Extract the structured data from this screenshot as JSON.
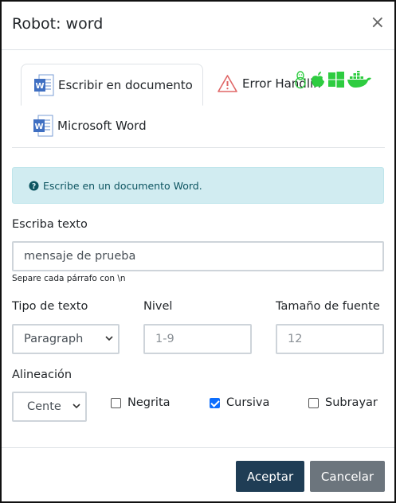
{
  "modal": {
    "title": "Robot: word",
    "close_symbol": "×"
  },
  "tabs": {
    "active": "Escribir en documento",
    "error": "Error Handlin",
    "second": "Microsoft Word",
    "icons": [
      "word-icon",
      "warning-icon",
      "linux-icon",
      "apple-icon",
      "windows-icon",
      "docker-icon"
    ]
  },
  "alert": {
    "icon": "question-circle-icon",
    "text": "Escribe en un documento Word."
  },
  "form": {
    "text_label": "Escriba texto",
    "text_value": "mensaje de prueba",
    "text_help": "Separe cada párrafo con \\n",
    "type_label": "Tipo de texto",
    "type_value": "Paragraph",
    "level_label": "Nivel",
    "level_placeholder": "1-9",
    "size_label": "Tamaño de fuente",
    "size_placeholder": "12",
    "align_label": "Alineación",
    "align_value": "Cente",
    "bold_label": "Negrita",
    "bold_checked": false,
    "italic_label": "Cursiva",
    "italic_checked": true,
    "underline_label": "Subrayar",
    "underline_checked": false
  },
  "footer": {
    "accept": "Aceptar",
    "cancel": "Cancelar"
  },
  "colors": {
    "primary": "#1f3d55",
    "secondary": "#6c757d",
    "alert_bg": "#d1ecf1",
    "os_icon_green": "#2ecc40",
    "checkbox": "#0d6efd"
  }
}
